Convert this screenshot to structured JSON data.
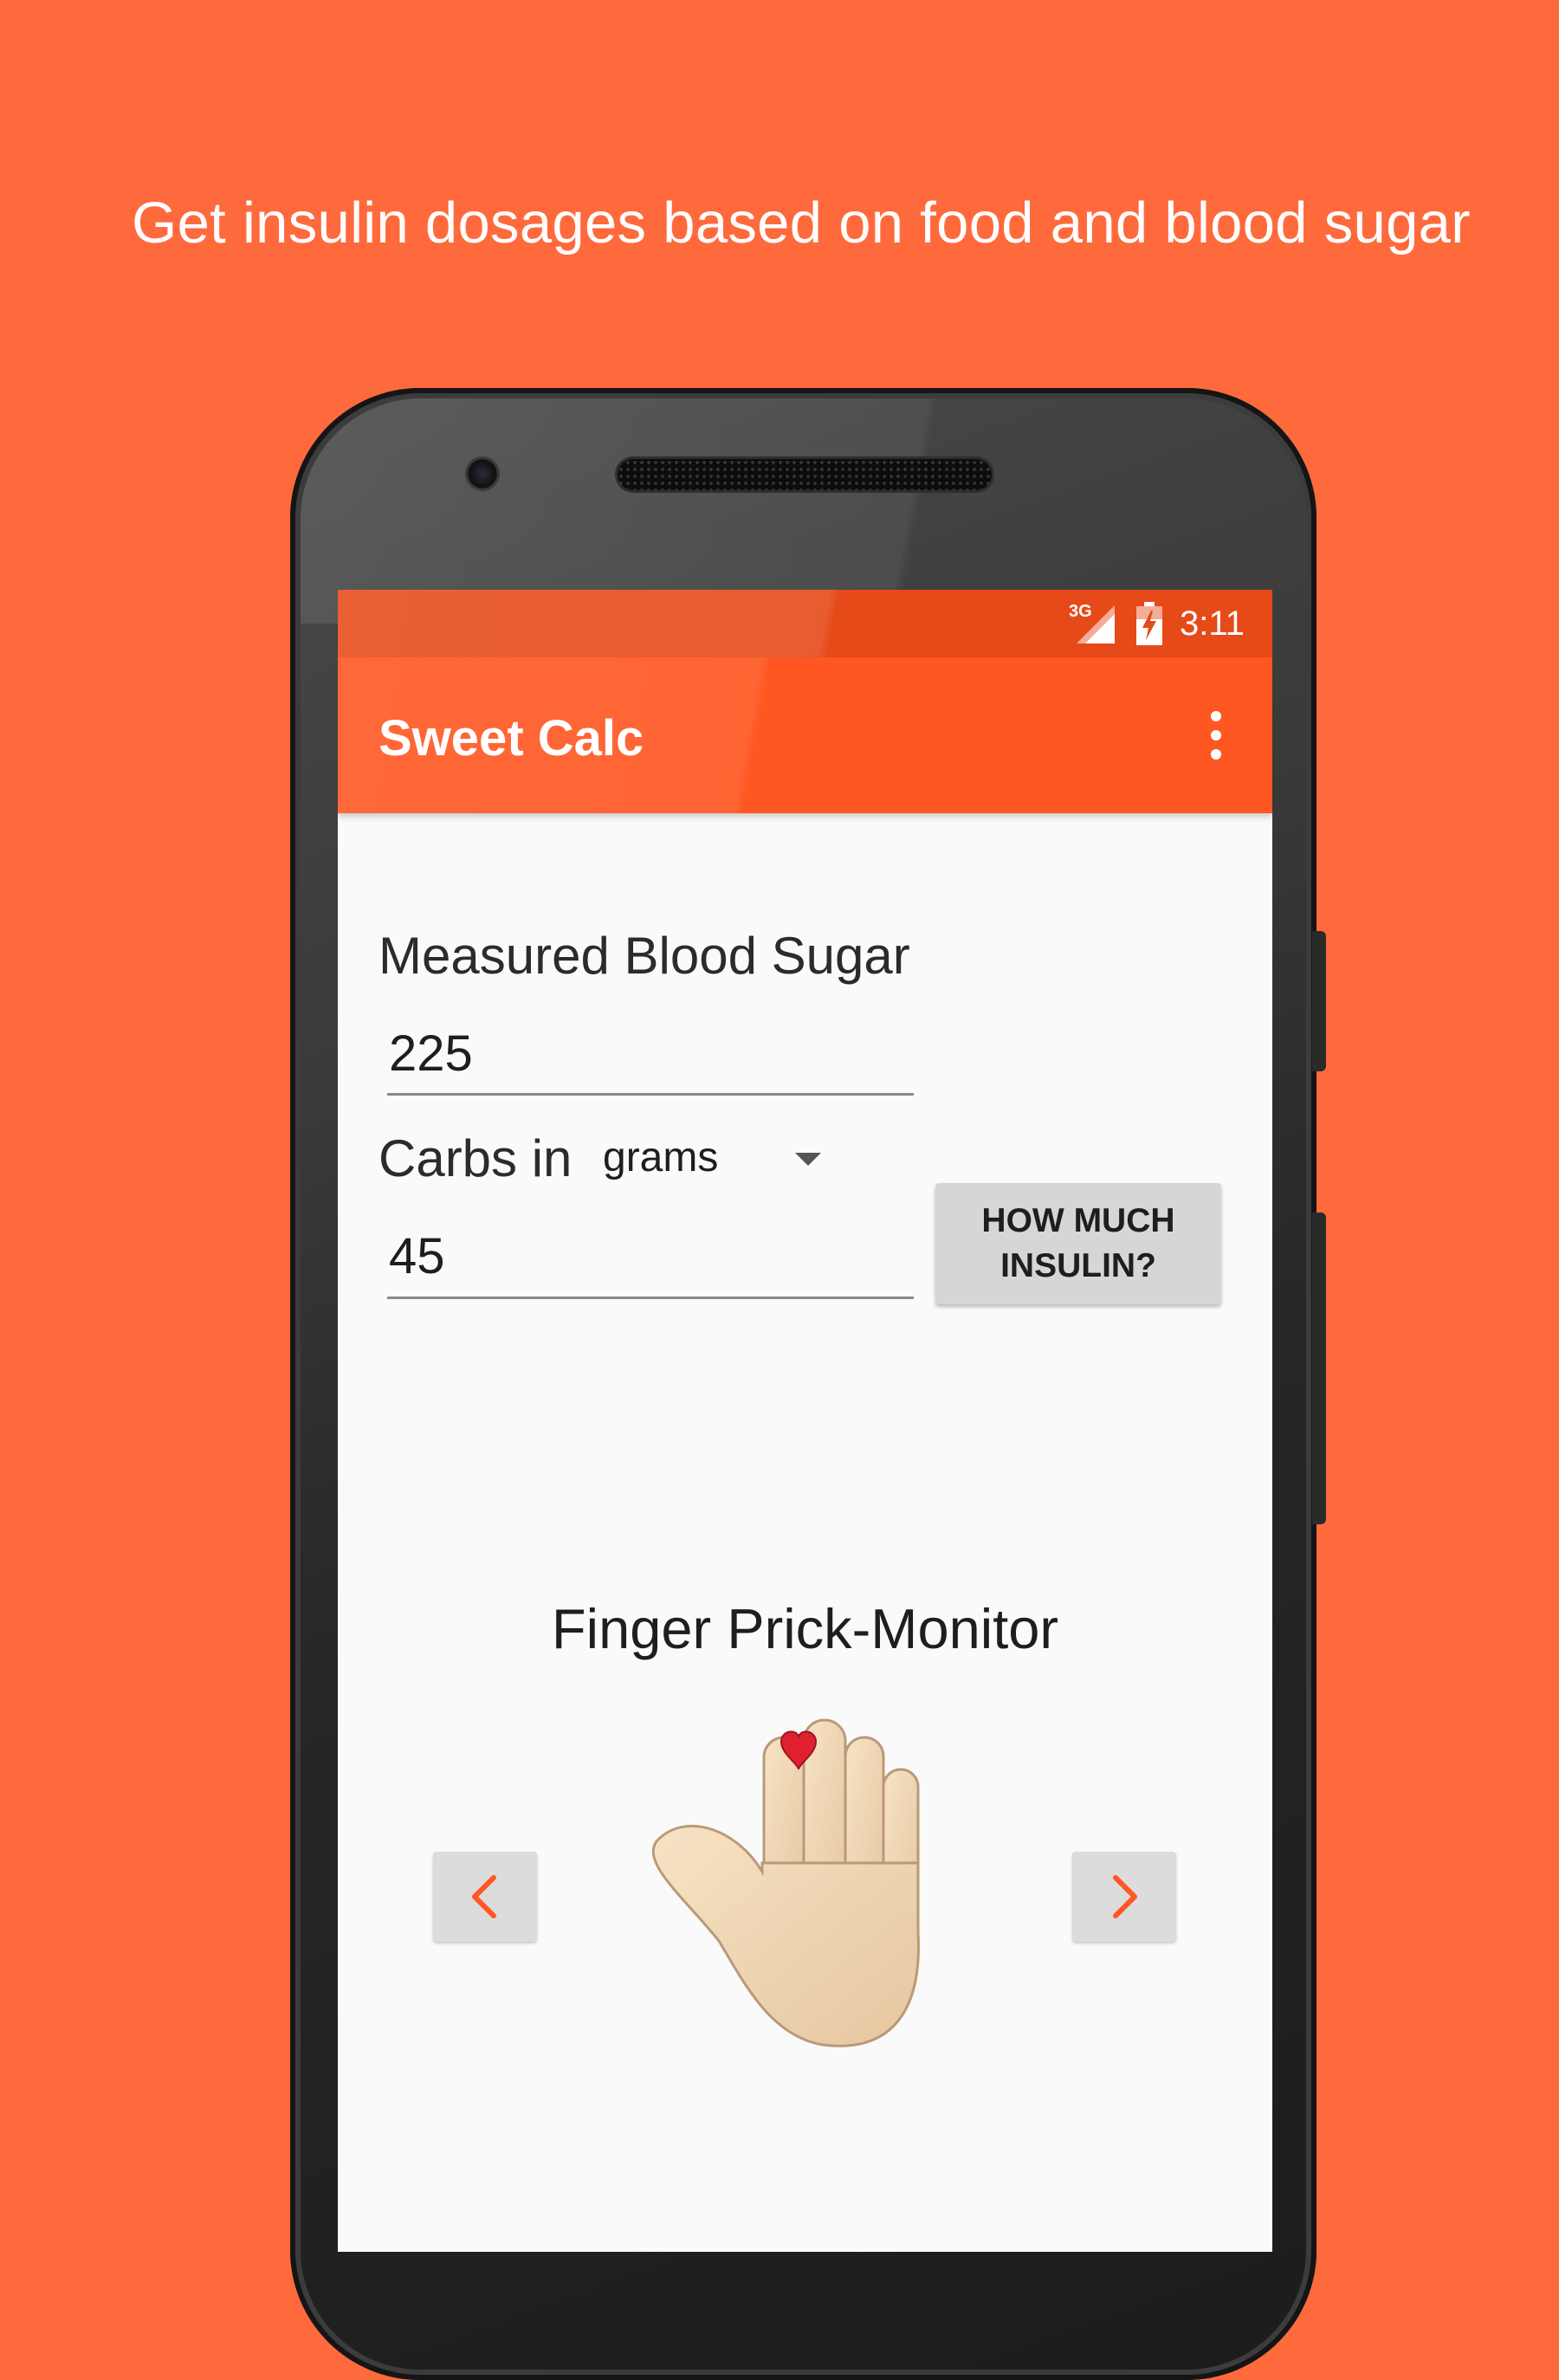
{
  "headline": "Get insulin dosages based on food and blood sugar",
  "status_bar": {
    "network": "3G",
    "time": "3:11"
  },
  "toolbar": {
    "title": "Sweet Calc",
    "overflow_icon": "more-vert-icon"
  },
  "form": {
    "blood_sugar_label": "Measured Blood Sugar",
    "blood_sugar_value": "225",
    "carbs_label": "Carbs in",
    "carbs_unit_selected": "grams",
    "carbs_value": "45",
    "calculate_button": "HOW MUCH INSULIN?"
  },
  "monitor": {
    "title": "Finger Prick-Monitor",
    "prev_icon": "chevron-left-icon",
    "next_icon": "chevron-right-icon",
    "image_icon": "raised-hand-with-heart-icon"
  },
  "colors": {
    "background": "#ff6a3d",
    "toolbar": "#ff5722",
    "status_bar": "#e64a19",
    "accent": "#ff5722"
  }
}
